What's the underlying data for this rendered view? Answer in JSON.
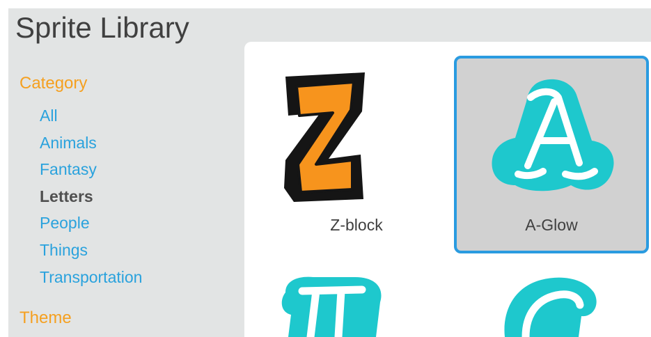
{
  "header": {
    "title": "Sprite Library"
  },
  "sidebar": {
    "category_heading": "Category",
    "categories": [
      {
        "label": "All",
        "selected": false
      },
      {
        "label": "Animals",
        "selected": false
      },
      {
        "label": "Fantasy",
        "selected": false
      },
      {
        "label": "Letters",
        "selected": true
      },
      {
        "label": "People",
        "selected": false
      },
      {
        "label": "Things",
        "selected": false
      },
      {
        "label": "Transportation",
        "selected": false
      }
    ],
    "theme_heading": "Theme"
  },
  "sprites": [
    {
      "name": "Z-block",
      "selected": false,
      "icon": "z-block-icon"
    },
    {
      "name": "A-Glow",
      "selected": true,
      "icon": "a-glow-icon"
    },
    {
      "name": "",
      "selected": false,
      "icon": "b-glow-icon"
    },
    {
      "name": "",
      "selected": false,
      "icon": "c-glow-icon"
    }
  ],
  "colors": {
    "accent_orange": "#f5a020",
    "link_blue": "#2aa2dd",
    "selection_border": "#2a9be0",
    "glow_teal": "#1ec8cd"
  }
}
